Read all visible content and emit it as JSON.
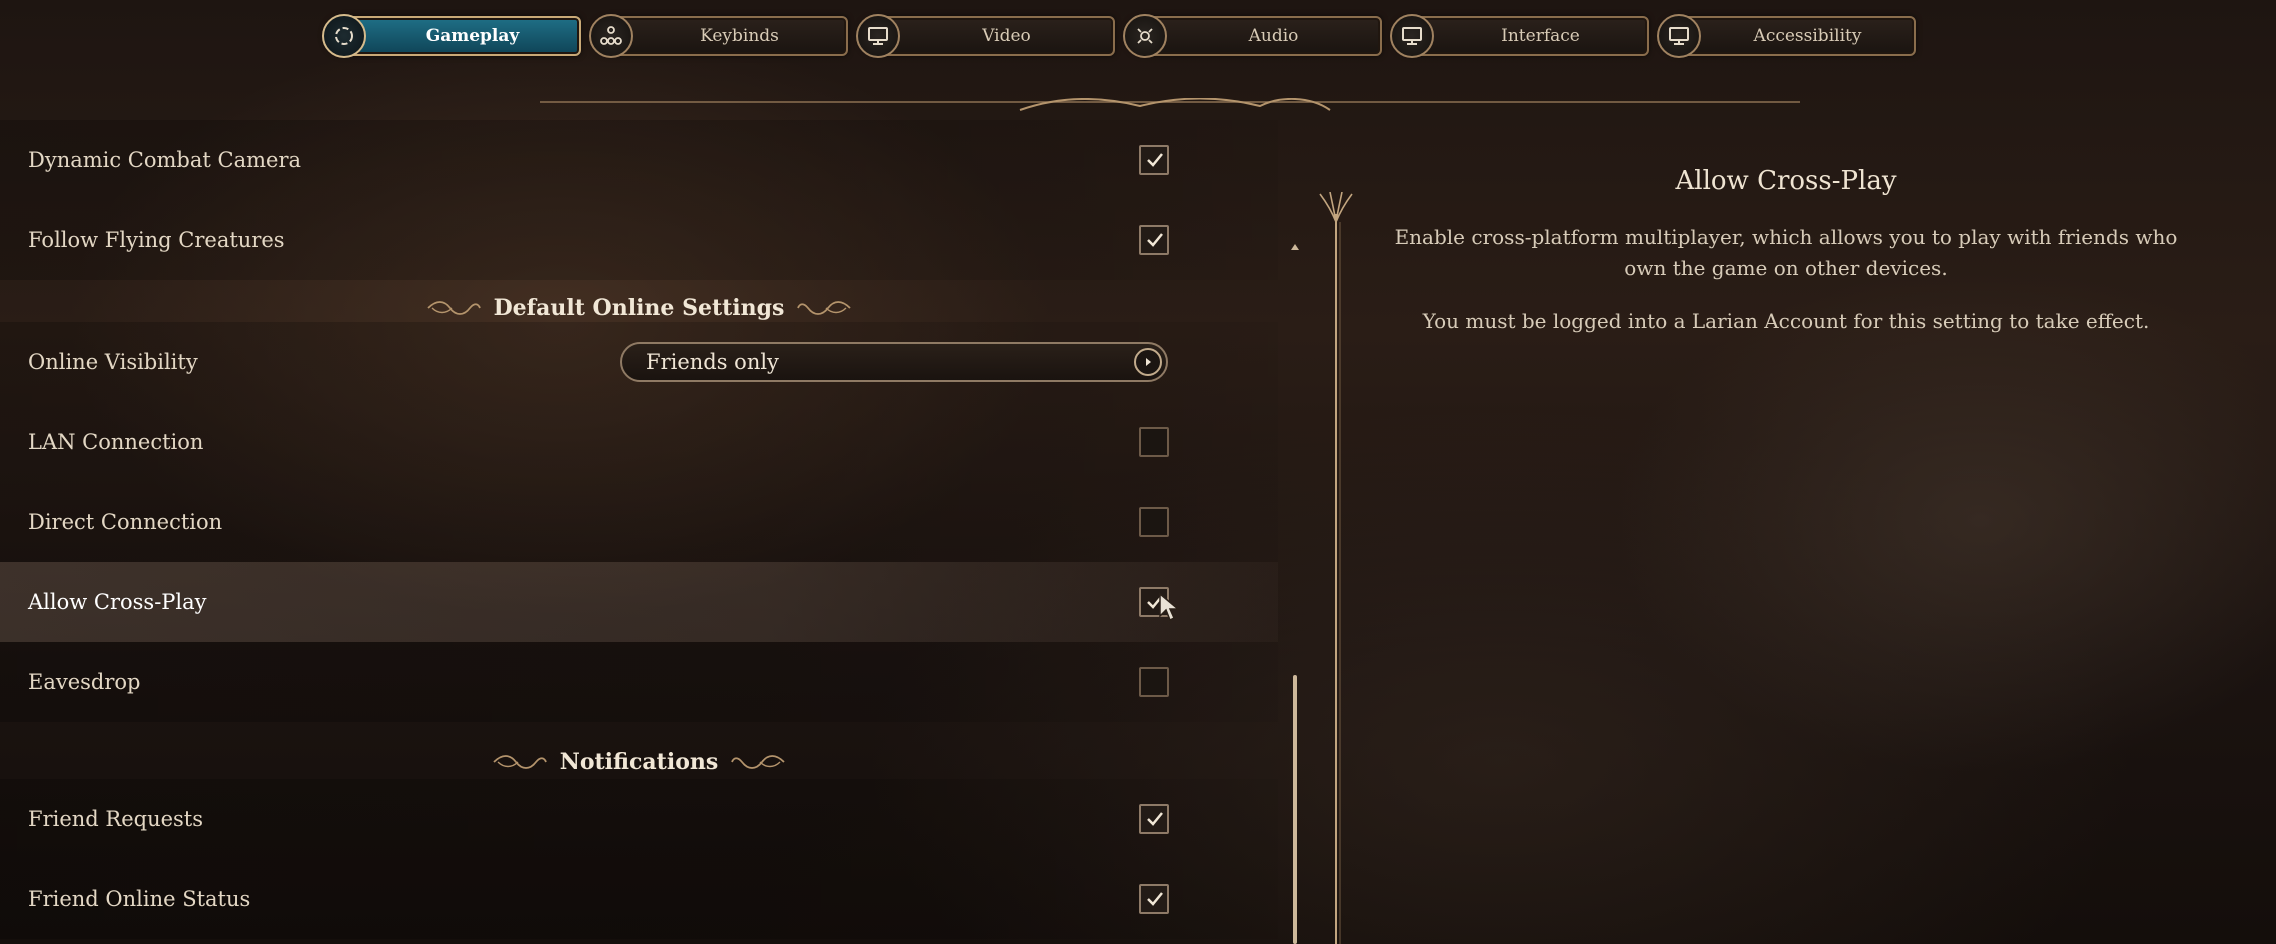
{
  "tabs": [
    {
      "label": "Gameplay",
      "icon": "gameplay-icon",
      "active": true
    },
    {
      "label": "Keybinds",
      "icon": "keybinds-icon",
      "active": false
    },
    {
      "label": "Video",
      "icon": "monitor-icon",
      "active": false
    },
    {
      "label": "Audio",
      "icon": "audio-icon",
      "active": false
    },
    {
      "label": "Interface",
      "icon": "monitor-icon",
      "active": false
    },
    {
      "label": "Accessibility",
      "icon": "monitor-icon",
      "active": false
    }
  ],
  "settings": {
    "dynamic_combat_camera": {
      "label": "Dynamic Combat Camera",
      "checked": true
    },
    "follow_flying_creatures": {
      "label": "Follow Flying Creatures",
      "checked": true
    },
    "section_online": "Default Online Settings",
    "online_visibility": {
      "label": "Online Visibility",
      "value": "Friends only"
    },
    "lan_connection": {
      "label": "LAN Connection",
      "checked": false
    },
    "direct_connection": {
      "label": "Direct Connection",
      "checked": false
    },
    "allow_cross_play": {
      "label": "Allow Cross-Play",
      "checked": true
    },
    "eavesdrop": {
      "label": "Eavesdrop",
      "checked": false
    },
    "section_notifications": "Notifications",
    "friend_requests": {
      "label": "Friend Requests",
      "checked": true
    },
    "friend_online_status": {
      "label": "Friend Online Status",
      "checked": true
    }
  },
  "description": {
    "title": "Allow Cross-Play",
    "paragraph1": "Enable cross-platform multiplayer, which allows you to play with friends who own the game on other devices.",
    "paragraph2": "You must be logged into a Larian Account for this setting to take effect."
  },
  "colors": {
    "active_tab": "#1f6f86",
    "frame_gold": "#8a6d4c",
    "text": "#e3d7c4"
  }
}
